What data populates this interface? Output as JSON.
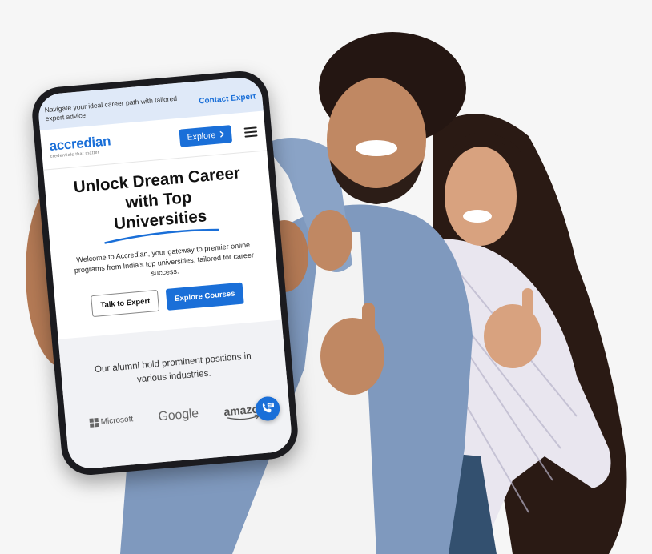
{
  "topbar": {
    "message": "Navigate your ideal career path with tailored expert advice",
    "contact": "Contact Expert"
  },
  "brand": {
    "name": "accredian",
    "tagline": "credentials that matter"
  },
  "nav": {
    "explore": "Explore"
  },
  "hero": {
    "title_line1": "Unlock Dream Career",
    "title_line2": "with Top",
    "title_line3": "Universities",
    "subtitle": "Welcome to Accredian, your gateway to premier online programs from India's top universities, tailored for career success.",
    "cta_talk": "Talk to Expert",
    "cta_explore": "Explore Courses"
  },
  "alumni": {
    "text": "Our alumni hold prominent positions in various industries.",
    "logos": [
      "Microsoft",
      "Google",
      "amazon"
    ]
  },
  "colors": {
    "accent": "#1a6fd8",
    "topbar_bg": "#dfe9f8",
    "alumni_bg": "#f1f2f5"
  }
}
